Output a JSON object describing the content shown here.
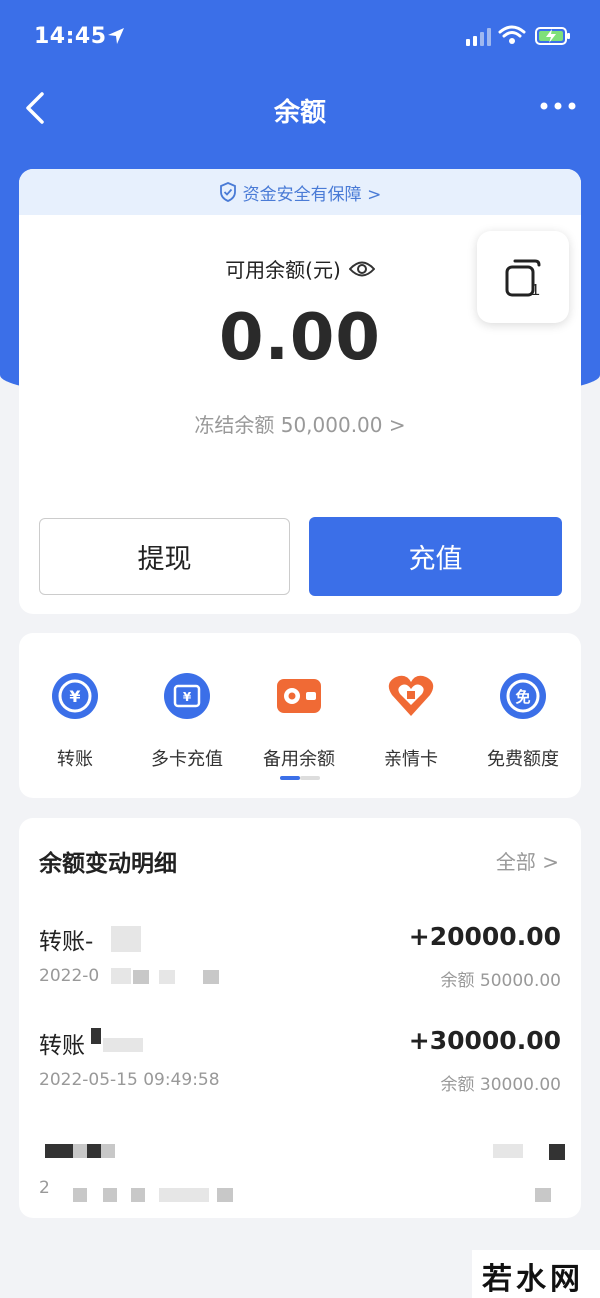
{
  "status_bar": {
    "time": "14:45"
  },
  "nav": {
    "title": "余额"
  },
  "balance_card": {
    "safety_banner": "资金安全有保障 >",
    "available_label": "可用余额(元)",
    "available_amount": "0.00",
    "frozen_text": "冻结余额 50,000.00 >",
    "withdraw_label": "提现",
    "recharge_label": "充值"
  },
  "services": [
    {
      "label": "转账",
      "icon": "transfer-icon"
    },
    {
      "label": "多卡充值",
      "icon": "wallet-card-icon"
    },
    {
      "label": "备用余额",
      "icon": "reserve-wallet-icon"
    },
    {
      "label": "亲情卡",
      "icon": "family-card-icon"
    },
    {
      "label": "免费额度",
      "icon": "free-quota-icon"
    }
  ],
  "details": {
    "title": "余额变动明细",
    "all_label": "全部 >",
    "rows": [
      {
        "name": "转账-",
        "amount": "+20000.00",
        "date": "2022-0",
        "balance": "余额 50000.00"
      },
      {
        "name": "转账",
        "amount": "+30000.00",
        "date": "2022-05-15 09:49:58",
        "balance": "余额 30000.00"
      },
      {
        "name": "",
        "amount": "",
        "date": "2",
        "balance": ""
      }
    ]
  },
  "watermark": {
    "text": "若水网"
  },
  "colors": {
    "primary": "#3b6fe8",
    "orange": "#f06a35",
    "banner_bg": "#e7f0fd"
  }
}
